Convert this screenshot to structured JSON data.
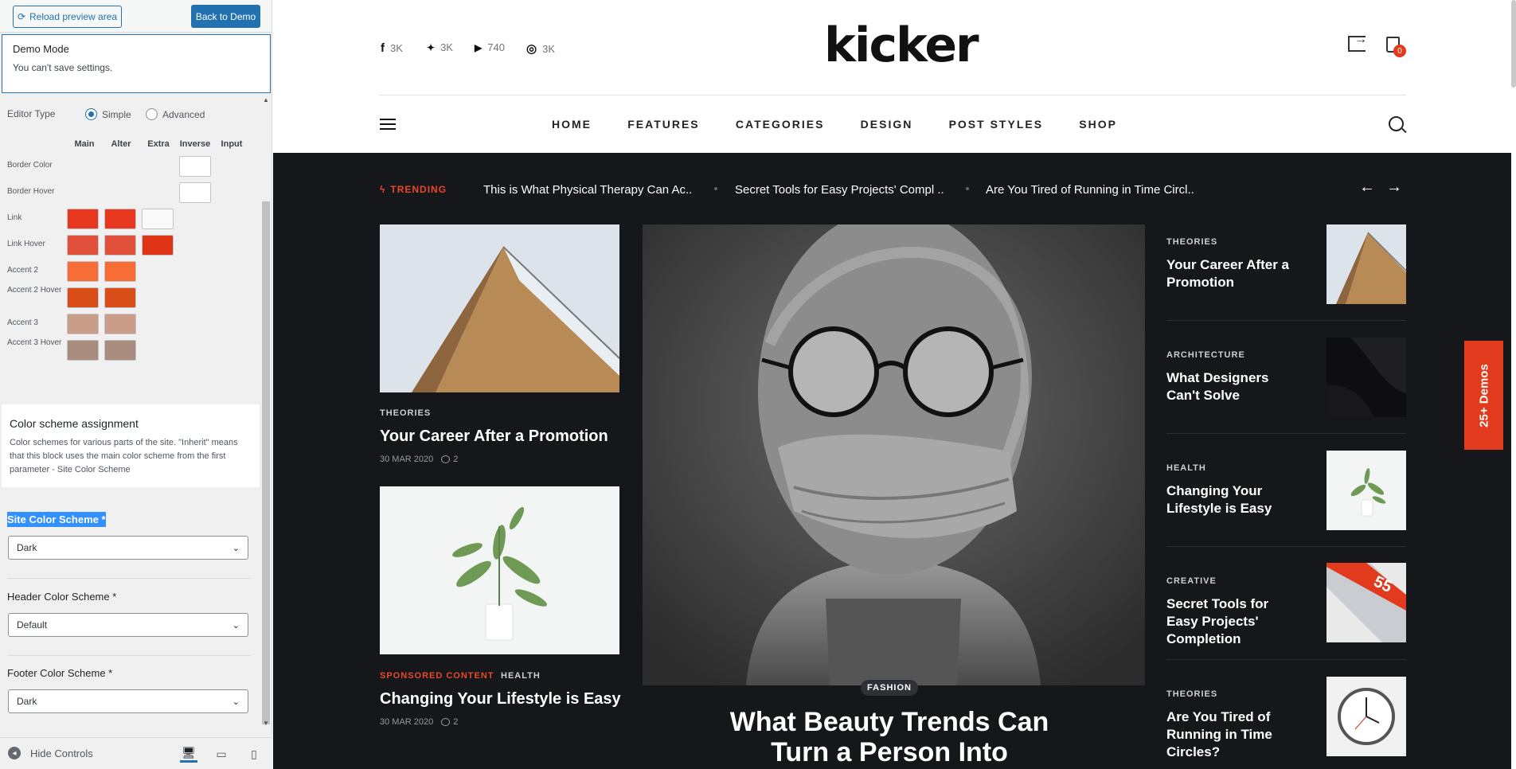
{
  "customizer": {
    "reload_label": "Reload preview area",
    "back_label": "Back to Demo",
    "demo_title": "Demo Mode",
    "demo_text": "You can't save settings.",
    "editor_type_label": "Editor Type",
    "editor_types": [
      {
        "label": "Simple",
        "selected": true
      },
      {
        "label": "Advanced",
        "selected": false
      }
    ],
    "columns": [
      "Main",
      "Alter",
      "Extra",
      "Inverse",
      "Input"
    ],
    "color_rows": [
      {
        "label": "Border Color",
        "swatches": {
          "input": "#ffffff"
        }
      },
      {
        "label": "Border Hover",
        "swatches": {
          "input": "#ffffff"
        }
      },
      {
        "label": "Link",
        "swatches": {
          "main": "#e8371f",
          "alter": "#e8371f",
          "extra": "#f9f9f9"
        }
      },
      {
        "label": "Link Hover",
        "swatches": {
          "main": "#e0503a",
          "alter": "#e0503a",
          "extra": "#e03417"
        }
      },
      {
        "label": "Accent 2",
        "swatches": {
          "main": "#f86c35",
          "alter": "#f86c35"
        }
      },
      {
        "label": "Accent 2 Hover",
        "swatches": {
          "main": "#d84d18",
          "alter": "#d84d18"
        }
      },
      {
        "label": "Accent 3",
        "swatches": {
          "main": "#c99d87",
          "alter": "#c99d87"
        }
      },
      {
        "label": "Accent 3 Hover",
        "swatches": {
          "main": "#a88c7d",
          "alter": "#a88c7d"
        }
      }
    ],
    "assign_title": "Color scheme assignment",
    "assign_text": "Color schemes for various parts of the site. \"Inherit\" means that this block uses the main color scheme from the first parameter - Site Color Scheme",
    "site_scheme_label": "Site Color Scheme *",
    "site_scheme_value": "Dark",
    "header_scheme_label": "Header Color Scheme *",
    "header_scheme_value": "Default",
    "footer_scheme_label": "Footer Color Scheme *",
    "footer_scheme_value": "Dark",
    "hide_controls": "Hide Controls",
    "devices": [
      "desktop-icon",
      "tablet-icon",
      "mobile-icon"
    ]
  },
  "site": {
    "logo": "kicker",
    "social": [
      {
        "icon": "facebook-icon",
        "glyph": "f",
        "count": "3K"
      },
      {
        "icon": "twitter-icon",
        "glyph": "🐦",
        "count": "3K"
      },
      {
        "icon": "youtube-icon",
        "glyph": "▶",
        "count": "740"
      },
      {
        "icon": "instagram-icon",
        "glyph": "◎",
        "count": "3K"
      }
    ],
    "cart_count": "0",
    "nav": [
      "HOME",
      "FEATURES",
      "CATEGORIES",
      "DESIGN",
      "POST STYLES",
      "SHOP"
    ],
    "trending_label": "TRENDING",
    "trending": [
      "This is What Physical Therapy Can Ac..",
      "Secret Tools for Easy Projects' Compl ..",
      "Are You Tired of Running in Time Circl.."
    ],
    "left_posts": [
      {
        "categories": [
          "THEORIES"
        ],
        "title": "Your Career After a Promotion",
        "date": "30 MAR 2020",
        "comments": "2"
      },
      {
        "categories": [
          "SPONSORED CONTENT",
          "HEALTH"
        ],
        "title": "Changing Your Lifestyle is Easy",
        "date": "30 MAR 2020",
        "comments": "2"
      }
    ],
    "hero": {
      "category": "FASHION",
      "title": "What Beauty Trends Can Turn a Person Into"
    },
    "side_posts": [
      {
        "category": "THEORIES",
        "title": "Your Career After a Promotion"
      },
      {
        "category": "ARCHITECTURE",
        "title": "What Designers Can't Solve"
      },
      {
        "category": "HEALTH",
        "title": "Changing Your Lifestyle is Easy"
      },
      {
        "category": "CREATIVE",
        "title": "Secret Tools for Easy Projects' Completion"
      },
      {
        "category": "THEORIES",
        "title": "Are You Tired of Running in Time Circles?"
      }
    ],
    "demos_tab": "25+ Demos",
    "colors": {
      "accent": "#e23a1c",
      "dark_bg": "#16171b",
      "wp_blue": "#2271b1"
    }
  }
}
